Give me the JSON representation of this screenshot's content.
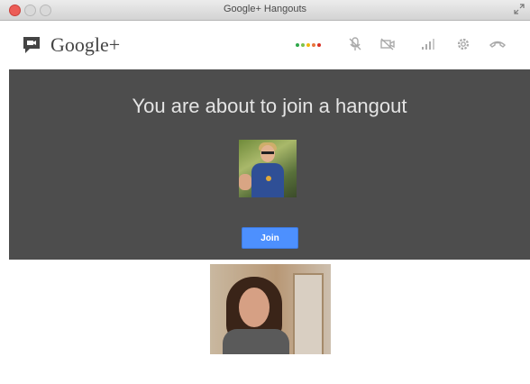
{
  "window": {
    "title": "Google+ Hangouts"
  },
  "header": {
    "brand": "Google+",
    "signal_colors": [
      "#2ea84a",
      "#7cc24a",
      "#f2b90c",
      "#e8743b",
      "#d93025"
    ]
  },
  "toolbar": {
    "icons": [
      "signal-dots-icon",
      "microphone-icon",
      "camera-icon",
      "bandwidth-icon",
      "settings-icon",
      "hang-up-icon"
    ]
  },
  "stage": {
    "heading": "You are about to join a hangout",
    "join_label": "Join"
  },
  "colors": {
    "stage_background": "#4d4d4d",
    "join_button": "#4d90fe"
  }
}
